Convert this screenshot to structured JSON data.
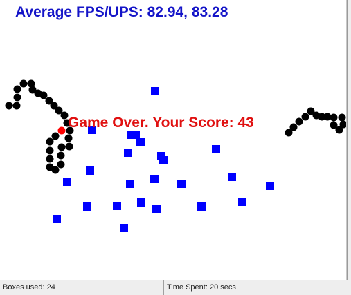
{
  "hud": {
    "fps_text": "Average FPS/UPS: 82.94, 83.28",
    "game_over_text": "Game Over. Your Score: 43"
  },
  "status_bar": {
    "boxes_used": "Boxes used: 24",
    "time_spent": "Time Spent: 20 secs"
  },
  "colors": {
    "hud_text": "#1414c8",
    "game_over": "#e01010",
    "box": "#0000ff",
    "worm_body": "#000000",
    "worm_head": "#ff0000",
    "background": "#ffffff"
  }
}
